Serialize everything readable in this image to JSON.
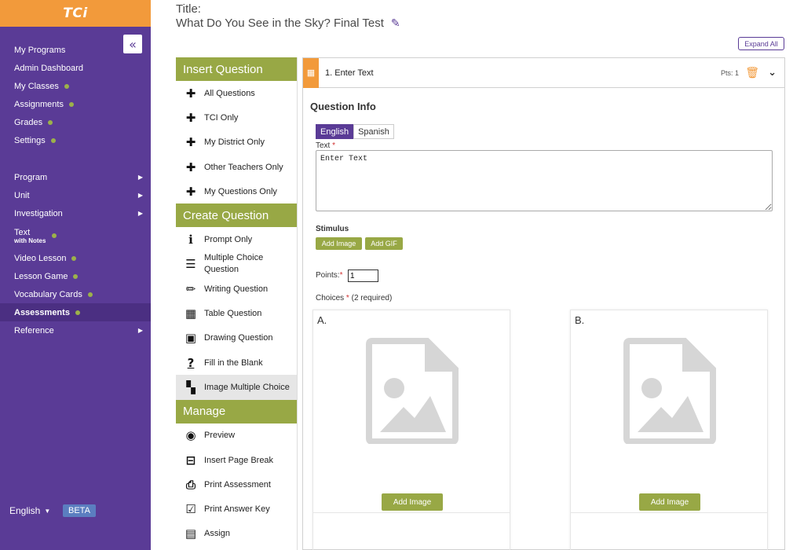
{
  "brand": {
    "logo": "TCi"
  },
  "sidebar": {
    "collapse_icon": "double-chevron-left-icon",
    "top_items": [
      {
        "label": "My Programs",
        "dot": false
      },
      {
        "label": "Admin Dashboard",
        "dot": false
      },
      {
        "label": "My Classes",
        "dot": true
      },
      {
        "label": "Assignments",
        "dot": true
      },
      {
        "label": "Grades",
        "dot": true
      },
      {
        "label": "Settings",
        "dot": true
      }
    ],
    "bottom_items": [
      {
        "label": "Program",
        "arrow": true
      },
      {
        "label": "Unit",
        "arrow": true
      },
      {
        "label": "Investigation",
        "arrow": true
      },
      {
        "label": "Text",
        "sub": "with Notes",
        "dot": true
      },
      {
        "label": "Video Lesson",
        "dot": true
      },
      {
        "label": "Lesson Game",
        "dot": true
      },
      {
        "label": "Vocabulary Cards",
        "dot": true
      },
      {
        "label": "Assessments",
        "dot": true,
        "active": true
      },
      {
        "label": "Reference",
        "arrow": true
      }
    ],
    "language": "English",
    "beta": "BETA"
  },
  "header": {
    "title_label": "Title:",
    "title": "What Do You See in the Sky? Final Test",
    "expand_all": "Expand All"
  },
  "panel": {
    "insert_heading": "Insert Question",
    "insert_items": [
      "All Questions",
      "TCI Only",
      "My District Only",
      "Other Teachers Only",
      "My Questions Only"
    ],
    "create_heading": "Create Question",
    "create_items": [
      {
        "label": "Prompt Only",
        "icon": "info-icon"
      },
      {
        "label": "Multiple Choice Question",
        "icon": "list-icon"
      },
      {
        "label": "Writing Question",
        "icon": "pencil-icon"
      },
      {
        "label": "Table Question",
        "icon": "table-icon"
      },
      {
        "label": "Drawing Question",
        "icon": "image-icon"
      },
      {
        "label": "Fill in the Blank",
        "icon": "question-icon"
      },
      {
        "label": "Image Multiple Choice",
        "icon": "grid-icon"
      }
    ],
    "manage_heading": "Manage",
    "manage_items": [
      {
        "label": "Preview",
        "icon": "eye-icon"
      },
      {
        "label": "Insert Page Break",
        "icon": "page-break-icon"
      },
      {
        "label": "Print Assessment",
        "icon": "printer-icon"
      },
      {
        "label": "Print Answer Key",
        "icon": "checkbox-icon"
      },
      {
        "label": "Assign",
        "icon": "calendar-icon"
      }
    ]
  },
  "question": {
    "number_label": "1. Enter Text",
    "pts": "Pts: 1",
    "info_title": "Question Info",
    "tabs": [
      "English",
      "Spanish"
    ],
    "text_label": "Text",
    "text_value": "Enter Text",
    "stimulus_label": "Stimulus",
    "add_image": "Add Image",
    "add_gif": "Add GIF",
    "points_label": "Points:",
    "points_value": "1",
    "choices_label": "Choices",
    "choices_note": "(2 required)",
    "choices": [
      {
        "letter": "A.",
        "button": "Add Image"
      },
      {
        "letter": "B.",
        "button": "Add Image"
      }
    ]
  },
  "colors": {
    "sidebar": "#5a3b96",
    "accent_orange": "#f29a3b",
    "accent_green": "#98a845"
  }
}
